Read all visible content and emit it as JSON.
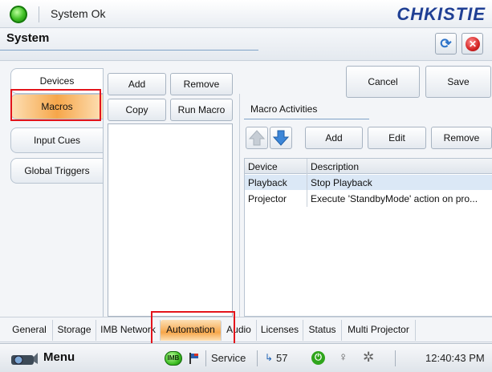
{
  "status": {
    "text": "System Ok",
    "color": "#3fbf24"
  },
  "brand": "CHKISTIE",
  "header": {
    "title": "System"
  },
  "side_tabs": [
    {
      "label": "Devices"
    },
    {
      "label": "Macros"
    },
    {
      "label": "Input Cues"
    },
    {
      "label": "Global Triggers"
    }
  ],
  "macro_buttons": {
    "add": "Add",
    "remove": "Remove",
    "copy": "Copy",
    "run": "Run Macro"
  },
  "actions": {
    "cancel": "Cancel",
    "save": "Save"
  },
  "activities": {
    "label": "Macro Activities",
    "buttons": {
      "add": "Add",
      "edit": "Edit",
      "remove": "Remove"
    },
    "columns": [
      "Device",
      "Description"
    ],
    "rows": [
      {
        "device": "Playback",
        "description": "Stop Playback"
      },
      {
        "device": "Projector",
        "description": "Execute 'StandbyMode' action on pro..."
      }
    ]
  },
  "bottom_tabs": [
    {
      "label": "General"
    },
    {
      "label": "Storage"
    },
    {
      "label": "IMB Network"
    },
    {
      "label": "Automation"
    },
    {
      "label": "Audio"
    },
    {
      "label": "Licenses"
    },
    {
      "label": "Status"
    },
    {
      "label": "Multi Projector"
    }
  ],
  "taskbar": {
    "menu": "Menu",
    "imb_badge": "IMB",
    "service": "Service",
    "count": "57",
    "clock": "12:40:43 PM"
  },
  "accent_colors": {
    "brand": "#1f3f94",
    "active_tab": "#f6a64a",
    "highlight": "#e3141b"
  }
}
